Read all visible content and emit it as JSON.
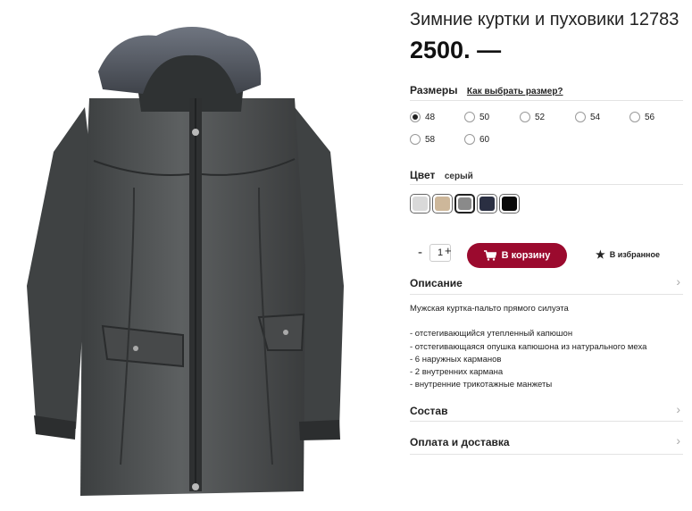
{
  "product": {
    "title": "Зимние куртки и пуховики 12783",
    "price": "2500. —"
  },
  "sizes": {
    "label": "Размеры",
    "help_link": "Как выбрать размер?",
    "options": [
      "48",
      "50",
      "52",
      "54",
      "56",
      "58",
      "60"
    ],
    "selected": "48"
  },
  "color": {
    "label": "Цвет",
    "value": "серый",
    "swatches": [
      "#d9d9d9",
      "#cdb79a",
      "#8a8a8a",
      "#2a2f42",
      "#0a0a0a"
    ],
    "selected_index": 2
  },
  "cart": {
    "minus": "-",
    "quantity": "1",
    "plus": "+",
    "button_label": "В корзину",
    "favorite_label": "В избранное",
    "accent": "#9b0a2e"
  },
  "description": {
    "heading": "Описание",
    "intro": "Мужская куртка-пальто прямого силуэта",
    "features": [
      "- отстегивающийся утепленный капюшон",
      "- отстегивающаяся опушка капюшона из натурального меха",
      "- 6 наружных карманов",
      "- 2 внутренних кармана",
      "- внутренние трикотажные манжеты"
    ]
  },
  "sections": {
    "composition": "Состав",
    "payment": "Оплата и доставка"
  }
}
